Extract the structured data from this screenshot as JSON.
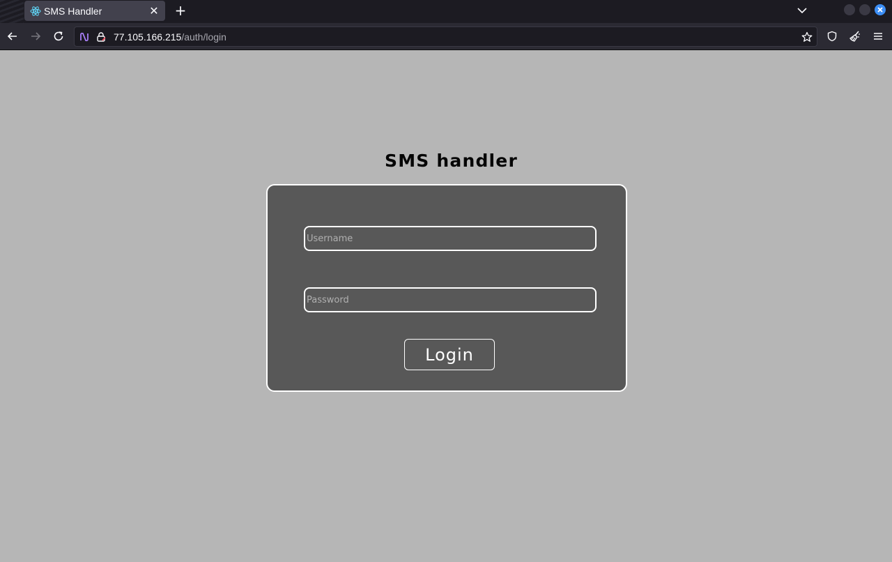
{
  "browser": {
    "tab": {
      "title": "SMS Handler",
      "favicon": "react-icon",
      "close_glyph": "✕"
    },
    "new_tab_glyph": "+",
    "url": {
      "host": "77.105.166.215",
      "path": "/auth/login"
    },
    "accent_color": "#3c8ef5"
  },
  "page": {
    "heading": "SMS handler",
    "form": {
      "username_placeholder": "Username",
      "password_placeholder": "Password",
      "login_label": "Login"
    },
    "colors": {
      "background": "#b6b6b6",
      "card": "#585858",
      "border": "#ffffff"
    }
  }
}
